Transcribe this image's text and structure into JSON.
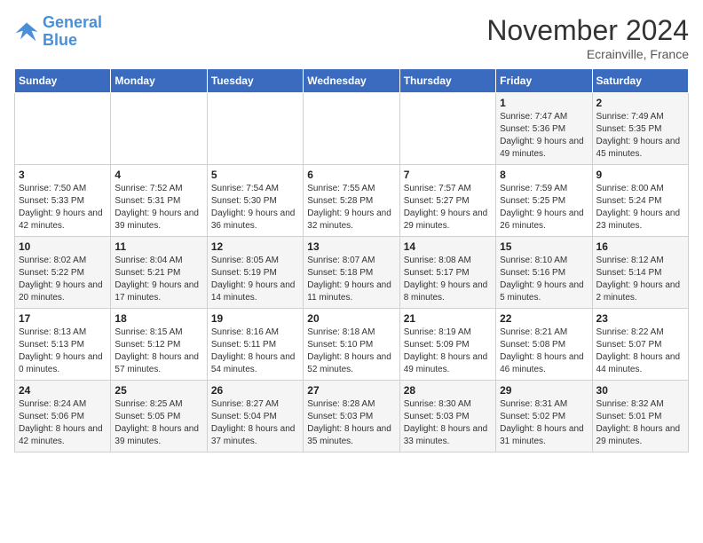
{
  "logo": {
    "line1": "General",
    "line2": "Blue"
  },
  "title": "November 2024",
  "location": "Ecrainville, France",
  "weekdays": [
    "Sunday",
    "Monday",
    "Tuesday",
    "Wednesday",
    "Thursday",
    "Friday",
    "Saturday"
  ],
  "weeks": [
    [
      {
        "day": "",
        "info": ""
      },
      {
        "day": "",
        "info": ""
      },
      {
        "day": "",
        "info": ""
      },
      {
        "day": "",
        "info": ""
      },
      {
        "day": "",
        "info": ""
      },
      {
        "day": "1",
        "info": "Sunrise: 7:47 AM\nSunset: 5:36 PM\nDaylight: 9 hours and 49 minutes."
      },
      {
        "day": "2",
        "info": "Sunrise: 7:49 AM\nSunset: 5:35 PM\nDaylight: 9 hours and 45 minutes."
      }
    ],
    [
      {
        "day": "3",
        "info": "Sunrise: 7:50 AM\nSunset: 5:33 PM\nDaylight: 9 hours and 42 minutes."
      },
      {
        "day": "4",
        "info": "Sunrise: 7:52 AM\nSunset: 5:31 PM\nDaylight: 9 hours and 39 minutes."
      },
      {
        "day": "5",
        "info": "Sunrise: 7:54 AM\nSunset: 5:30 PM\nDaylight: 9 hours and 36 minutes."
      },
      {
        "day": "6",
        "info": "Sunrise: 7:55 AM\nSunset: 5:28 PM\nDaylight: 9 hours and 32 minutes."
      },
      {
        "day": "7",
        "info": "Sunrise: 7:57 AM\nSunset: 5:27 PM\nDaylight: 9 hours and 29 minutes."
      },
      {
        "day": "8",
        "info": "Sunrise: 7:59 AM\nSunset: 5:25 PM\nDaylight: 9 hours and 26 minutes."
      },
      {
        "day": "9",
        "info": "Sunrise: 8:00 AM\nSunset: 5:24 PM\nDaylight: 9 hours and 23 minutes."
      }
    ],
    [
      {
        "day": "10",
        "info": "Sunrise: 8:02 AM\nSunset: 5:22 PM\nDaylight: 9 hours and 20 minutes."
      },
      {
        "day": "11",
        "info": "Sunrise: 8:04 AM\nSunset: 5:21 PM\nDaylight: 9 hours and 17 minutes."
      },
      {
        "day": "12",
        "info": "Sunrise: 8:05 AM\nSunset: 5:19 PM\nDaylight: 9 hours and 14 minutes."
      },
      {
        "day": "13",
        "info": "Sunrise: 8:07 AM\nSunset: 5:18 PM\nDaylight: 9 hours and 11 minutes."
      },
      {
        "day": "14",
        "info": "Sunrise: 8:08 AM\nSunset: 5:17 PM\nDaylight: 9 hours and 8 minutes."
      },
      {
        "day": "15",
        "info": "Sunrise: 8:10 AM\nSunset: 5:16 PM\nDaylight: 9 hours and 5 minutes."
      },
      {
        "day": "16",
        "info": "Sunrise: 8:12 AM\nSunset: 5:14 PM\nDaylight: 9 hours and 2 minutes."
      }
    ],
    [
      {
        "day": "17",
        "info": "Sunrise: 8:13 AM\nSunset: 5:13 PM\nDaylight: 9 hours and 0 minutes."
      },
      {
        "day": "18",
        "info": "Sunrise: 8:15 AM\nSunset: 5:12 PM\nDaylight: 8 hours and 57 minutes."
      },
      {
        "day": "19",
        "info": "Sunrise: 8:16 AM\nSunset: 5:11 PM\nDaylight: 8 hours and 54 minutes."
      },
      {
        "day": "20",
        "info": "Sunrise: 8:18 AM\nSunset: 5:10 PM\nDaylight: 8 hours and 52 minutes."
      },
      {
        "day": "21",
        "info": "Sunrise: 8:19 AM\nSunset: 5:09 PM\nDaylight: 8 hours and 49 minutes."
      },
      {
        "day": "22",
        "info": "Sunrise: 8:21 AM\nSunset: 5:08 PM\nDaylight: 8 hours and 46 minutes."
      },
      {
        "day": "23",
        "info": "Sunrise: 8:22 AM\nSunset: 5:07 PM\nDaylight: 8 hours and 44 minutes."
      }
    ],
    [
      {
        "day": "24",
        "info": "Sunrise: 8:24 AM\nSunset: 5:06 PM\nDaylight: 8 hours and 42 minutes."
      },
      {
        "day": "25",
        "info": "Sunrise: 8:25 AM\nSunset: 5:05 PM\nDaylight: 8 hours and 39 minutes."
      },
      {
        "day": "26",
        "info": "Sunrise: 8:27 AM\nSunset: 5:04 PM\nDaylight: 8 hours and 37 minutes."
      },
      {
        "day": "27",
        "info": "Sunrise: 8:28 AM\nSunset: 5:03 PM\nDaylight: 8 hours and 35 minutes."
      },
      {
        "day": "28",
        "info": "Sunrise: 8:30 AM\nSunset: 5:03 PM\nDaylight: 8 hours and 33 minutes."
      },
      {
        "day": "29",
        "info": "Sunrise: 8:31 AM\nSunset: 5:02 PM\nDaylight: 8 hours and 31 minutes."
      },
      {
        "day": "30",
        "info": "Sunrise: 8:32 AM\nSunset: 5:01 PM\nDaylight: 8 hours and 29 minutes."
      }
    ]
  ]
}
